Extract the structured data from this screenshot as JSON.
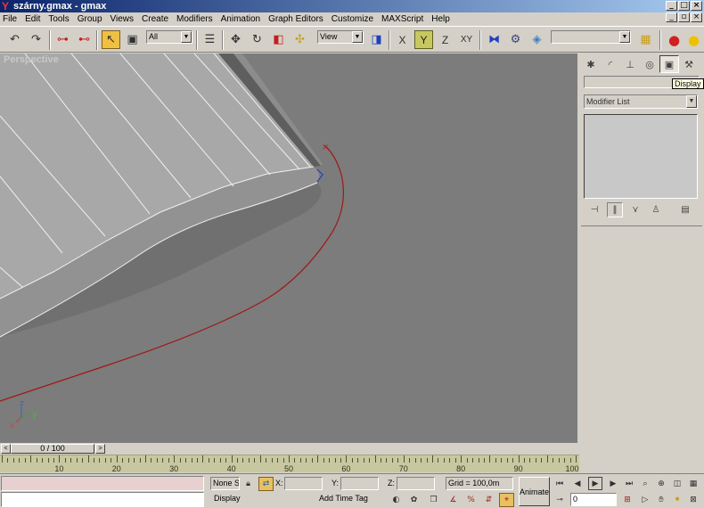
{
  "window": {
    "title": "szárny.gmax - gmax"
  },
  "menu": [
    "File",
    "Edit",
    "Tools",
    "Group",
    "Views",
    "Create",
    "Modifiers",
    "Animation",
    "Graph Editors",
    "Customize",
    "MAXScript",
    "Help"
  ],
  "toolbar": {
    "selection_filter": "All",
    "ref_coord": "View",
    "axis_x": "X",
    "axis_y": "Y",
    "axis_z": "Z",
    "axis_xy": "XY",
    "named_selection": ""
  },
  "viewport": {
    "label": "Perspective"
  },
  "command_panel": {
    "tooltip": "Display",
    "modifier_list": "Modifier List"
  },
  "time_slider": {
    "value": "0 / 100",
    "prev": "<",
    "next": ">"
  },
  "trackbar": {
    "ticks": [
      "10",
      "20",
      "30",
      "40",
      "50",
      "60",
      "70",
      "80",
      "90",
      "100"
    ]
  },
  "status": {
    "selection": "None S",
    "x_label": "X:",
    "y_label": "Y:",
    "z_label": "Z:",
    "x_value": "",
    "y_value": "",
    "z_value": "",
    "grid": "Grid = 100,0m",
    "prompt": "Display",
    "add_time_tag": "Add Time Tag",
    "animate": "Animate",
    "frame": "0"
  },
  "colors": {
    "viewport_bg": "#7c7c7c",
    "curve": "#a01818",
    "trackbar": "#c8c8a0",
    "listener_top": "#e8d0d0"
  }
}
